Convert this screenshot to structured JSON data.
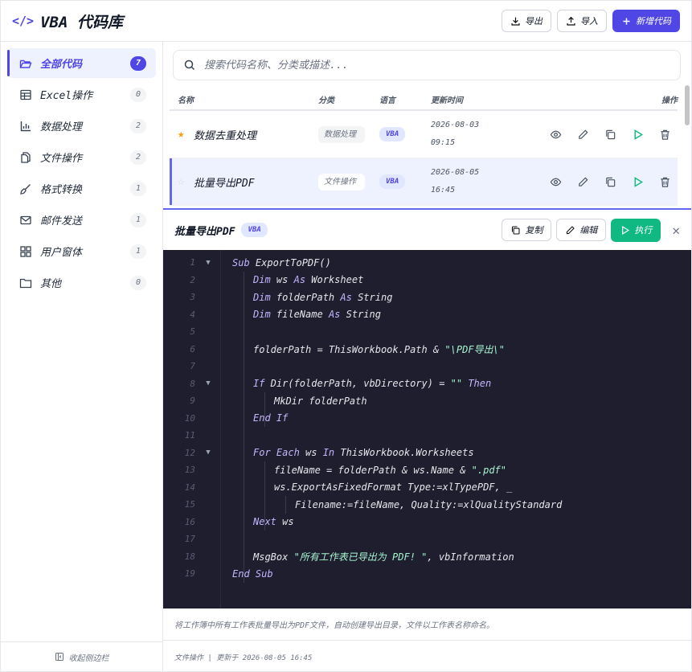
{
  "app": {
    "title": "VBA 代码库",
    "brand_icon": "</>"
  },
  "header": {
    "export_label": "导出",
    "import_label": "导入",
    "new_label": "新增代码"
  },
  "sidebar": {
    "items": [
      {
        "label": "全部代码",
        "count": "7",
        "icon": "folder-open-icon"
      },
      {
        "label": "Excel操作",
        "count": "0",
        "icon": "table-icon"
      },
      {
        "label": "数据处理",
        "count": "2",
        "icon": "bar-chart-icon"
      },
      {
        "label": "文件操作",
        "count": "2",
        "icon": "file-copy-icon"
      },
      {
        "label": "格式转换",
        "count": "1",
        "icon": "brush-icon"
      },
      {
        "label": "邮件发送",
        "count": "1",
        "icon": "mail-icon"
      },
      {
        "label": "用户窗体",
        "count": "1",
        "icon": "grid-icon"
      },
      {
        "label": "其他",
        "count": "0",
        "icon": "folder-icon"
      }
    ],
    "collapse_label": "收起侧边栏"
  },
  "search": {
    "placeholder": "搜索代码名称、分类或描述..."
  },
  "table": {
    "headers": {
      "name": "名称",
      "category": "分类",
      "language": "语言",
      "updated": "更新时间",
      "actions": "操作"
    },
    "rows": [
      {
        "name": "数据去重处理",
        "category": "数据处理",
        "language": "VBA",
        "date": "2026-08-03",
        "time": "09:15",
        "starred": true
      },
      {
        "name": "批量导出PDF",
        "category": "文件操作",
        "language": "VBA",
        "date": "2026-08-05",
        "time": "16:45",
        "starred": false
      }
    ]
  },
  "detail": {
    "title": "批量导出PDF",
    "language": "VBA",
    "copy_label": "复制",
    "edit_label": "编辑",
    "run_label": "执行",
    "description": "将工作簿中所有工作表批量导出为PDF文件，自动创建导出目录，文件以工作表名称命名。",
    "meta": "文件操作 | 更新于 2026-08-05 16:45",
    "code_lines": [
      "Sub ExportToPDF()",
      "    Dim ws As Worksheet",
      "    Dim folderPath As String",
      "    Dim fileName As String",
      "",
      "    folderPath = ThisWorkbook.Path & \"\\PDF导出\\\"",
      "",
      "    If Dir(folderPath, vbDirectory) = \"\" Then",
      "        MkDir folderPath",
      "    End If",
      "",
      "    For Each ws In ThisWorkbook.Worksheets",
      "        fileName = folderPath & ws.Name & \".pdf\"",
      "        ws.ExportAsFixedFormat Type:=xlTypePDF, _",
      "            Filename:=fileName, Quality:=xlQualityStandard",
      "    Next ws",
      "",
      "    MsgBox \"所有工作表已导出为 PDF! \", vbInformation",
      "End Sub"
    ],
    "folded_lines": [
      1,
      8,
      12
    ]
  },
  "colors": {
    "accent": "#4f46e5",
    "run": "#10b981",
    "code_bg": "#1e1e2e",
    "star": "#f59e0b"
  }
}
